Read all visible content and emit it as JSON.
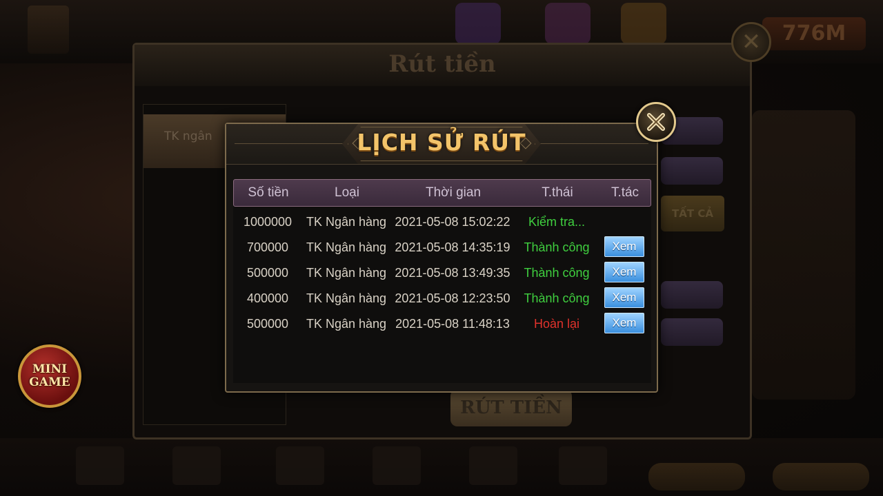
{
  "background": {
    "withdraw_title": "Rút tiền",
    "tab_bank": "TK ngân",
    "submit_label": "RÚT TIỀN",
    "all_label": "TẤT CẢ",
    "balance": "776M"
  },
  "minigame": {
    "line1": "MINI",
    "line2": "GAME"
  },
  "dialog": {
    "title": "LỊCH SỬ RÚT",
    "columns": [
      "Số tiền",
      "Loại",
      "Thời gian",
      "T.thái",
      "T.tác"
    ],
    "rows": [
      {
        "amount": "1000000",
        "type": "TK Ngân hàng",
        "time": "2021-05-08 15:02:22",
        "status": "Kiểm tra...",
        "status_color": "#3fcf3f",
        "action": ""
      },
      {
        "amount": "700000",
        "type": "TK Ngân hàng",
        "time": "2021-05-08 14:35:19",
        "status": "Thành công",
        "status_color": "#3fcf3f",
        "action": "Xem"
      },
      {
        "amount": "500000",
        "type": "TK Ngân hàng",
        "time": "2021-05-08 13:49:35",
        "status": "Thành công",
        "status_color": "#3fcf3f",
        "action": "Xem"
      },
      {
        "amount": "400000",
        "type": "TK Ngân hàng",
        "time": "2021-05-08 12:23:50",
        "status": "Thành công",
        "status_color": "#3fcf3f",
        "action": "Xem"
      },
      {
        "amount": "500000",
        "type": "TK Ngân hàng",
        "time": "2021-05-08 11:48:13",
        "status": "Hoàn lại",
        "status_color": "#e0322c",
        "action": "Xem"
      }
    ]
  },
  "icons": {
    "dialog_close": "close-icon",
    "panel_close": "close-icon"
  }
}
